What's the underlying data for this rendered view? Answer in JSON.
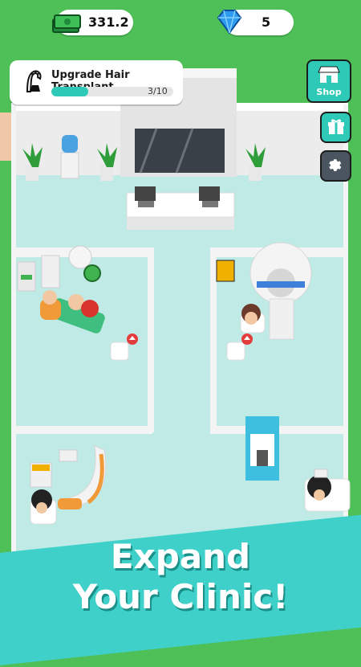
{
  "hud": {
    "cash": {
      "value": "331.2",
      "icon": "cash-stack-icon"
    },
    "gems": {
      "value": "5",
      "icon": "diamond-icon"
    }
  },
  "task": {
    "title": "Upgrade Hair Transplant",
    "progress_text": "3/10",
    "progress_fraction": 0.3,
    "icon": "hair-transplant-icon"
  },
  "side_menu": {
    "shop_label": "Shop",
    "shop_icon": "shop-icon",
    "gift_icon": "gift-icon",
    "settings_icon": "gear-icon"
  },
  "promo": {
    "line1": "Expand",
    "line2": "Your Clinic!"
  },
  "colors": {
    "accent": "#2fcab7",
    "floor": "#bfeae5",
    "banner": "#3fd0c9",
    "grass": "#4fbf57",
    "progress": "#2fcab7"
  }
}
